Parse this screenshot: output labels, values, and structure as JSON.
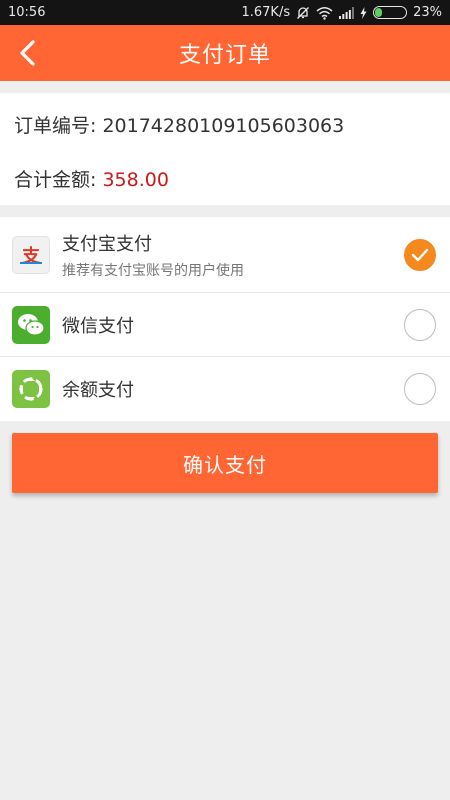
{
  "status_bar": {
    "time": "10:56",
    "speed": "1.67K/s",
    "battery": "23%",
    "battery_level": 0.23
  },
  "header": {
    "title": "支付订单"
  },
  "order": {
    "number_label": "订单编号: ",
    "number": "20174280109105603063",
    "total_label": "合计金额: ",
    "total": "358.00"
  },
  "payment_methods": [
    {
      "label": "支付宝支付",
      "sub": "推荐有支付宝账号的用户使用",
      "selected": true,
      "icon": "alipay-icon"
    },
    {
      "label": "微信支付",
      "selected": false,
      "icon": "wechat-icon"
    },
    {
      "label": "余额支付",
      "selected": false,
      "icon": "balance-icon"
    }
  ],
  "confirm_label": "确认支付",
  "colors": {
    "brand": "#ff6633",
    "amount": "#d01818",
    "check": "#f5891e"
  }
}
